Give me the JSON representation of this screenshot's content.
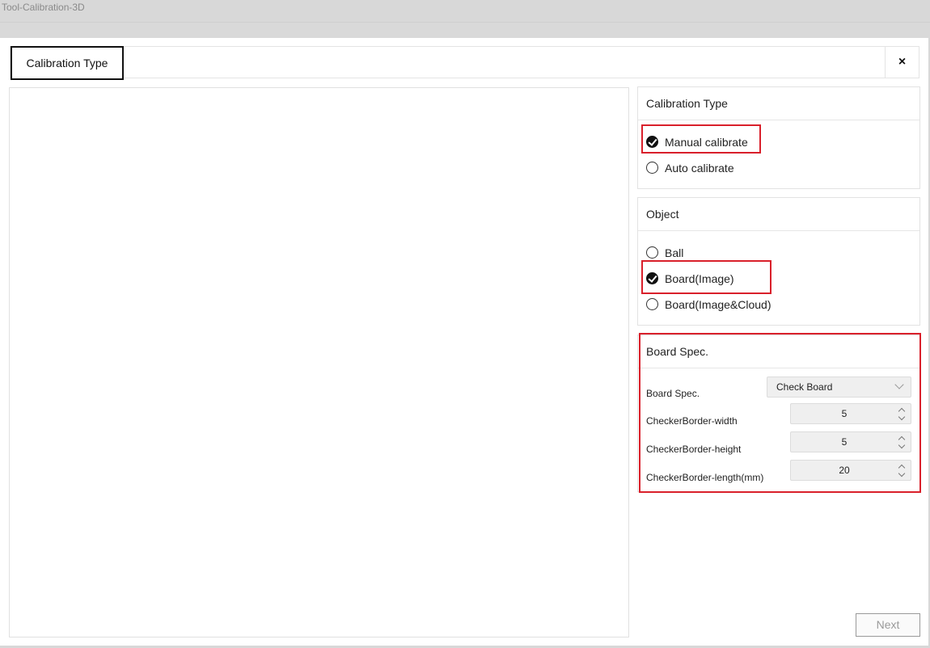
{
  "window": {
    "title": "Tool-Calibration-3D"
  },
  "tabs": [
    {
      "label": "Calibration Type",
      "active": true
    }
  ],
  "close": {
    "symbol": "×"
  },
  "calibration_type": {
    "header": "Calibration Type",
    "options": [
      {
        "label": "Manual calibrate",
        "checked": true
      },
      {
        "label": "Auto calibrate",
        "checked": false
      }
    ]
  },
  "object": {
    "header": "Object",
    "options": [
      {
        "label": "Ball",
        "checked": false
      },
      {
        "label": "Board(Image)",
        "checked": true
      },
      {
        "label": "Board(Image&Cloud)",
        "checked": false
      }
    ]
  },
  "board_spec": {
    "header": "Board Spec.",
    "spec_label": "Board Spec.",
    "spec_value": "Check Board",
    "width_label": "CheckerBorder-width",
    "width_value": "5",
    "height_label": "CheckerBorder-height",
    "height_value": "5",
    "length_label": "CheckerBorder-length(mm)",
    "length_value": "20"
  },
  "footer": {
    "next_label": "Next"
  },
  "colors": {
    "highlight": "#d9202b",
    "accent": "#111111"
  }
}
